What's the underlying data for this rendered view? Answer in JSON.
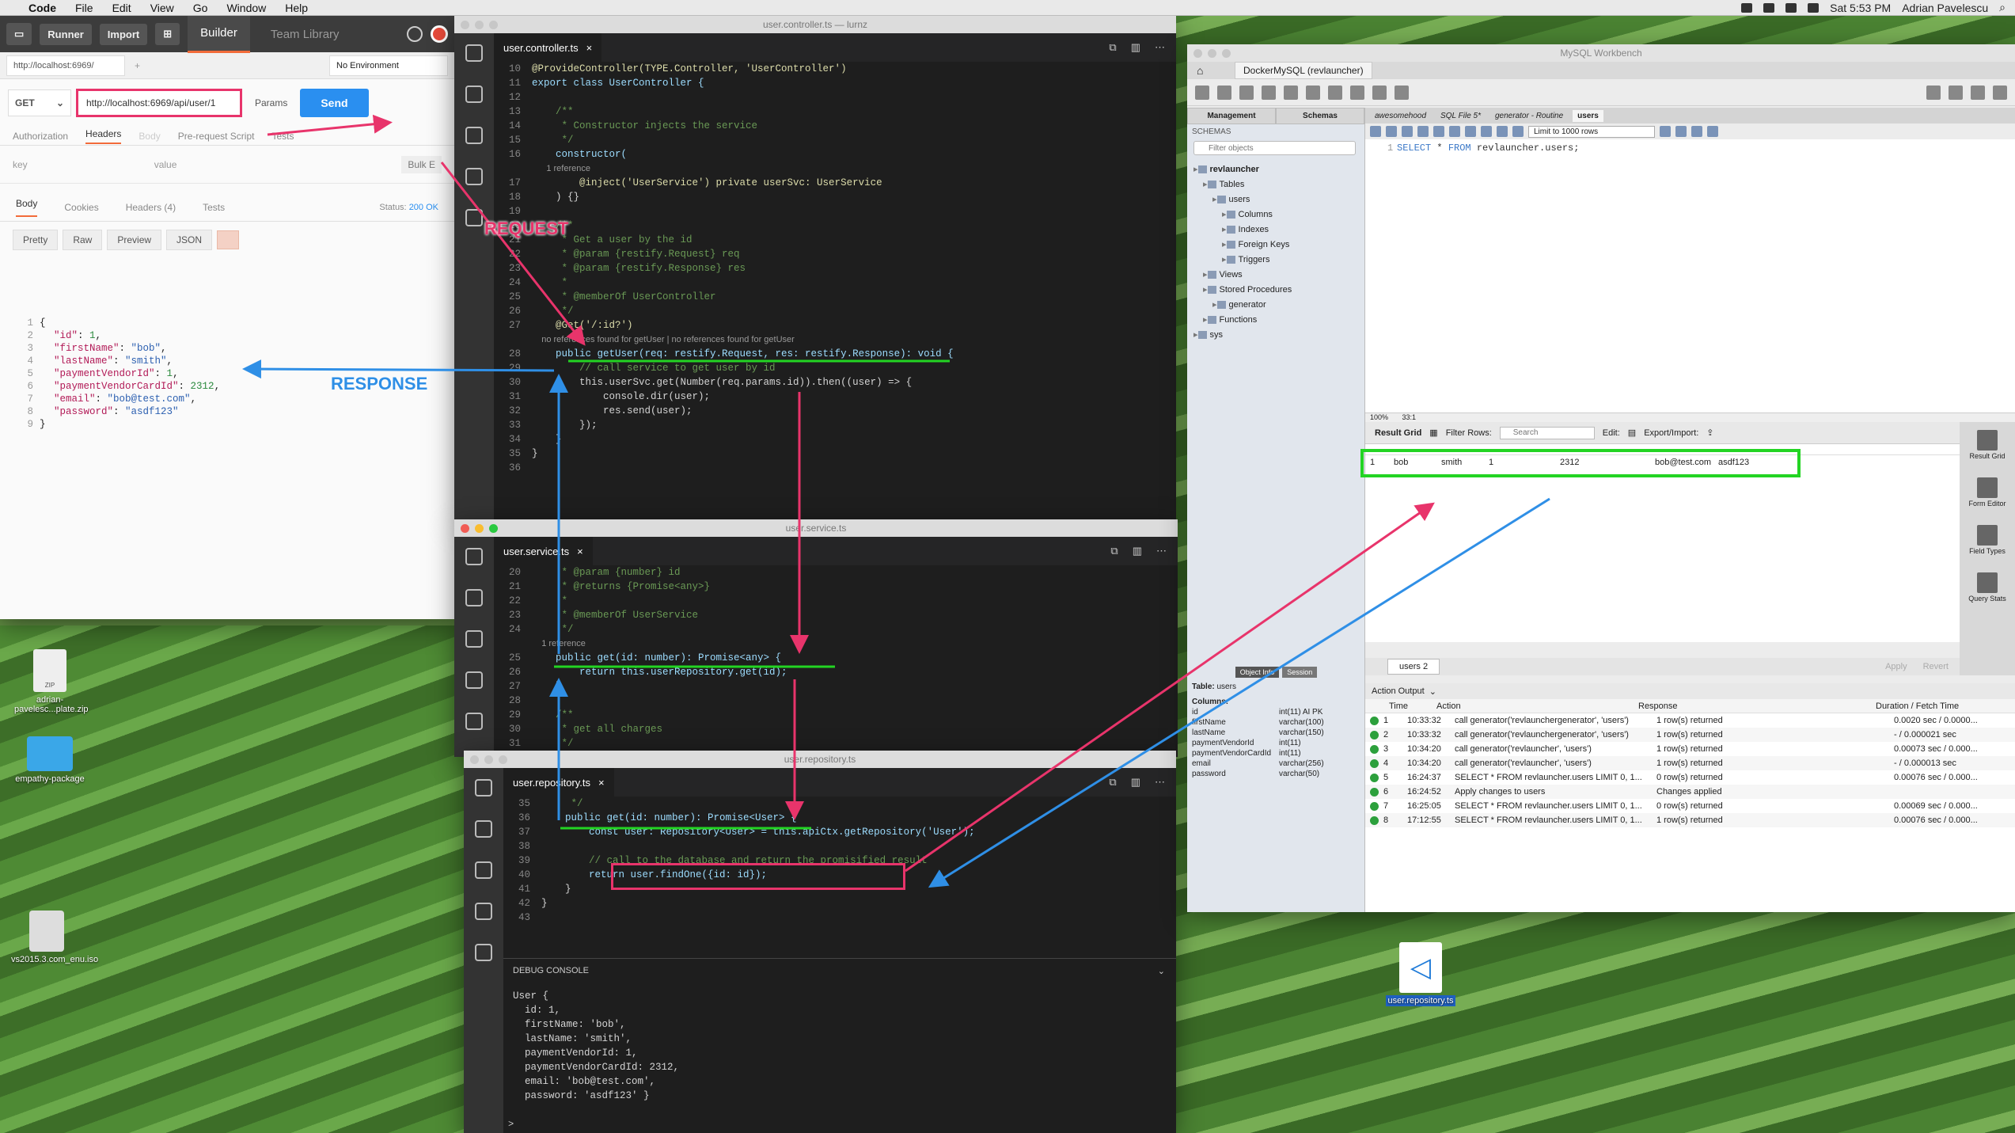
{
  "menubar": {
    "app": "Code",
    "items": [
      "File",
      "Edit",
      "View",
      "Go",
      "Window",
      "Help"
    ],
    "clock": "Sat 5:53 PM",
    "user": "Adrian Pavelescu"
  },
  "postman": {
    "buttons": {
      "runner": "Runner",
      "import": "Import"
    },
    "tabs": {
      "builder": "Builder",
      "team": "Team Library"
    },
    "url_tab": "http://localhost:6969/",
    "environment": "No Environment",
    "method": "GET",
    "url": "http://localhost:6969/api/user/1",
    "params": "Params",
    "send": "Send",
    "req_tabs": [
      "Authorization",
      "Headers",
      "Body",
      "Pre-request Script",
      "Tests"
    ],
    "kv": {
      "key": "key",
      "value": "value",
      "bulk": "Bulk E"
    },
    "resp_tabs": [
      "Body",
      "Cookies",
      "Headers (4)",
      "Tests"
    ],
    "status_label": "Status:",
    "status_value": "200 OK",
    "views": [
      "Pretty",
      "Raw",
      "Preview",
      "JSON"
    ],
    "json_lines": [
      {
        "n": "1",
        "t": "{"
      },
      {
        "n": "2",
        "k": "\"id\"",
        "v": "1",
        "type": "num"
      },
      {
        "n": "3",
        "k": "\"firstName\"",
        "v": "\"bob\"",
        "type": "str"
      },
      {
        "n": "4",
        "k": "\"lastName\"",
        "v": "\"smith\"",
        "type": "str"
      },
      {
        "n": "5",
        "k": "\"paymentVendorId\"",
        "v": "1",
        "type": "num"
      },
      {
        "n": "6",
        "k": "\"paymentVendorCardId\"",
        "v": "2312",
        "type": "num"
      },
      {
        "n": "7",
        "k": "\"email\"",
        "v": "\"bob@test.com\"",
        "type": "str"
      },
      {
        "n": "8",
        "k": "\"password\"",
        "v": "\"asdf123\"",
        "type": "str"
      },
      {
        "n": "9",
        "t": "}"
      }
    ]
  },
  "annotations": {
    "request": "REQUEST",
    "response": "RESPONSE"
  },
  "controller": {
    "window_title": "user.controller.ts — lurnz",
    "tab": "user.controller.ts",
    "lines": [
      [
        "10",
        "@ProvideController(TYPE.Controller, 'UserController')"
      ],
      [
        "11",
        "export class UserController {"
      ],
      [
        "12",
        ""
      ],
      [
        "13",
        "    /**"
      ],
      [
        "14",
        "     * Constructor injects the service"
      ],
      [
        "15",
        "     */"
      ],
      [
        "16",
        "    constructor("
      ],
      [
        "",
        "      1 reference"
      ],
      [
        "17",
        "        @inject('UserService') private userSvc: UserService"
      ],
      [
        "18",
        "    ) {}"
      ],
      [
        "19",
        ""
      ],
      [
        "20",
        "    /**"
      ],
      [
        "21",
        "     * Get a user by the id"
      ],
      [
        "22",
        "     * @param {restify.Request} req"
      ],
      [
        "23",
        "     * @param {restify.Response} res"
      ],
      [
        "24",
        "     *"
      ],
      [
        "25",
        "     * @memberOf UserController"
      ],
      [
        "26",
        "     */"
      ],
      [
        "27",
        "    @Get('/:id?')"
      ],
      [
        "",
        "    no references found for getUser | no references found for getUser"
      ],
      [
        "28",
        "    public getUser(req: restify.Request, res: restify.Response): void {"
      ],
      [
        "29",
        "        // call service to get user by id"
      ],
      [
        "30",
        "        this.userSvc.get(Number(req.params.id)).then((user) => {"
      ],
      [
        "31",
        "            console.dir(user);"
      ],
      [
        "32",
        "            res.send(user);"
      ],
      [
        "33",
        "        });"
      ],
      [
        "34",
        "    }"
      ],
      [
        "35",
        "}"
      ],
      [
        "36",
        ""
      ]
    ]
  },
  "service": {
    "window_title": "user.service.ts",
    "tab": "user.service.ts",
    "lines": [
      [
        "20",
        "     * @param {number} id"
      ],
      [
        "21",
        "     * @returns {Promise<any>}"
      ],
      [
        "22",
        "     *"
      ],
      [
        "23",
        "     * @memberOf UserService"
      ],
      [
        "24",
        "     */"
      ],
      [
        "",
        "    1 reference"
      ],
      [
        "25",
        "    public get(id: number): Promise<any> {"
      ],
      [
        "26",
        "        return this.userRepository.get(id);"
      ],
      [
        "27",
        "    }"
      ],
      [
        "28",
        ""
      ],
      [
        "29",
        "    /**"
      ],
      [
        "30",
        "     * get all charges"
      ],
      [
        "31",
        "     */"
      ]
    ]
  },
  "repository": {
    "window_title": "user.repository.ts",
    "tab": "user.repository.ts",
    "lines": [
      [
        "35",
        "     */"
      ],
      [
        "36",
        "    public get(id: number): Promise<User> {"
      ],
      [
        "37",
        "        const user: Repository<User> = this.apiCtx.getRepository('User');"
      ],
      [
        "38",
        ""
      ],
      [
        "39",
        "        // call to the database and return the promisified result"
      ],
      [
        "40",
        "        return user.findOne({id: id});"
      ],
      [
        "41",
        "    }"
      ],
      [
        "42",
        "}"
      ],
      [
        "43",
        ""
      ]
    ],
    "console_title": "DEBUG CONSOLE",
    "console": [
      "User {",
      "  id: 1,",
      "  firstName: 'bob',",
      "  lastName: 'smith',",
      "  paymentVendorId: 1,",
      "  paymentVendorCardId: 2312,",
      "  email: 'bob@test.com',",
      "  password: 'asdf123' }"
    ],
    "prompt": ">"
  },
  "workbench": {
    "title": "MySQL Workbench",
    "conn_tab": "DockerMySQL (revlauncher)",
    "left_tabs": [
      "Management",
      "Schemas"
    ],
    "schemas_label": "SCHEMAS",
    "filter_placeholder": "Filter objects",
    "tree": [
      {
        "d": 0,
        "t": "revlauncher",
        "b": true
      },
      {
        "d": 1,
        "t": "Tables"
      },
      {
        "d": 2,
        "t": "users"
      },
      {
        "d": 3,
        "t": "Columns"
      },
      {
        "d": 3,
        "t": "Indexes"
      },
      {
        "d": 3,
        "t": "Foreign Keys"
      },
      {
        "d": 3,
        "t": "Triggers"
      },
      {
        "d": 1,
        "t": "Views"
      },
      {
        "d": 1,
        "t": "Stored Procedures"
      },
      {
        "d": 2,
        "t": "generator"
      },
      {
        "d": 1,
        "t": "Functions"
      },
      {
        "d": 0,
        "t": "sys"
      }
    ],
    "info_tabs": [
      "Object Info",
      "Session"
    ],
    "table_label": "Table:",
    "table_name": "users",
    "columns_label": "Columns:",
    "columns": [
      [
        "id",
        "int(11) AI PK"
      ],
      [
        "firstName",
        "varchar(100)"
      ],
      [
        "lastName",
        "varchar(150)"
      ],
      [
        "paymentVendorId",
        "int(11)"
      ],
      [
        "paymentVendorCardId",
        "int(11)"
      ],
      [
        "email",
        "varchar(256)"
      ],
      [
        "password",
        "varchar(50)"
      ]
    ],
    "query_tabs": [
      "awesomehood",
      "SQL File 5*",
      "generator - Routine",
      "users"
    ],
    "limit": "Limit to 1000 rows",
    "sql_line": "1",
    "sql": {
      "kw1": "SELECT",
      "star": " * ",
      "kw2": "FROM",
      "rest": " revlauncher.users;"
    },
    "zoom": "100%",
    "pos": "33:1",
    "result_grid": "Result Grid",
    "filter_rows": "Filter Rows:",
    "search_placeholder": "Search",
    "edit": "Edit:",
    "export": "Export/Import:",
    "row": [
      "1",
      "bob",
      "smith",
      "1",
      "2312",
      "bob@test.com",
      "asdf123"
    ],
    "side": [
      "Result Grid",
      "Form Editor",
      "Field Types",
      "Query Stats"
    ],
    "result_tab": "users 2",
    "apply": "Apply",
    "revert": "Revert",
    "action_output": "Action Output",
    "out_cols": [
      "Time",
      "Action",
      "Response",
      "Duration / Fetch Time"
    ],
    "out_rows": [
      [
        "1",
        "10:33:32",
        "call generator('revlaunchergenerator', 'users')",
        "1 row(s) returned",
        "0.0020 sec / 0.0000..."
      ],
      [
        "2",
        "10:33:32",
        "call generator('revlaunchergenerator', 'users')",
        "1 row(s) returned",
        "- / 0.000021 sec"
      ],
      [
        "3",
        "10:34:20",
        "call generator('revlauncher', 'users')",
        "1 row(s) returned",
        "0.00073 sec / 0.000..."
      ],
      [
        "4",
        "10:34:20",
        "call generator('revlauncher', 'users')",
        "1 row(s) returned",
        "- / 0.000013 sec"
      ],
      [
        "5",
        "16:24:37",
        "SELECT * FROM revlauncher.users LIMIT 0, 1...",
        "0 row(s) returned",
        "0.00076 sec / 0.000..."
      ],
      [
        "6",
        "16:24:52",
        "Apply changes to users",
        "Changes applied",
        ""
      ],
      [
        "7",
        "16:25:05",
        "SELECT * FROM revlauncher.users LIMIT 0, 1...",
        "0 row(s) returned",
        "0.00069 sec / 0.000..."
      ],
      [
        "8",
        "17:12:55",
        "SELECT * FROM revlauncher.users LIMIT 0, 1...",
        "1 row(s) returned",
        "0.00076 sec / 0.000..."
      ]
    ]
  },
  "desktop": {
    "zip": "adrian-pavelesc...plate.zip",
    "zip_badge": "ZIP",
    "folder": "empathy-package",
    "iso": "vs2015.3.com_enu.iso",
    "ts": "user.repository.ts"
  },
  "colors": {
    "pink": "#e8346b",
    "blue": "#2f8fe6",
    "green": "#23d423"
  }
}
